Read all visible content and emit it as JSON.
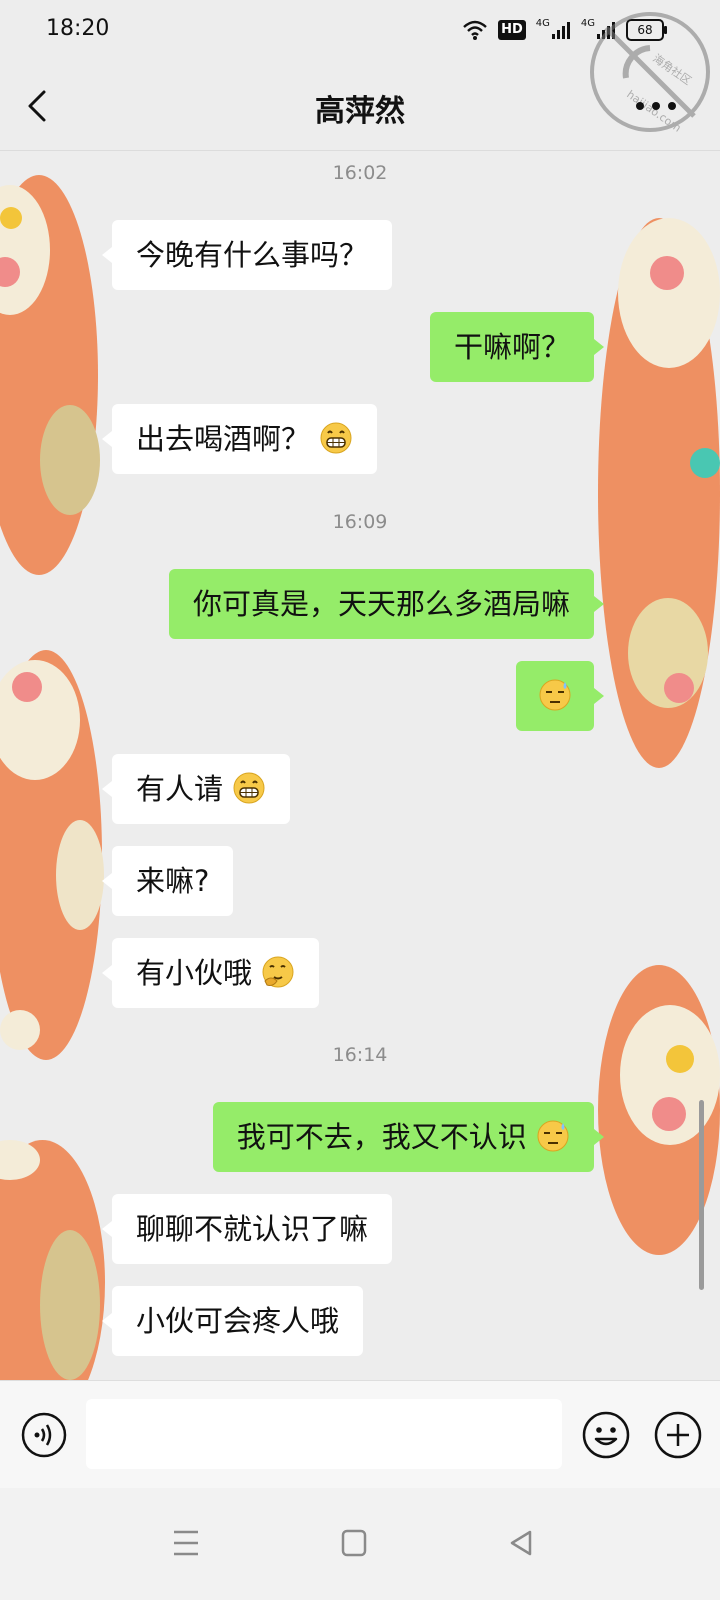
{
  "status_bar": {
    "time": "18:20",
    "network_1": "4G",
    "network_2": "4G",
    "battery": "68",
    "hd_label": "HD"
  },
  "watermark": {
    "line1": "海角社区",
    "line2": "haijiao.com"
  },
  "header": {
    "title": "高萍然"
  },
  "messages": [
    {
      "kind": "time",
      "text": "16:02"
    },
    {
      "kind": "msg",
      "side": "left",
      "text": "今晚有什么事吗？"
    },
    {
      "kind": "msg",
      "side": "right",
      "text": "干嘛啊？"
    },
    {
      "kind": "msg",
      "side": "left",
      "text": "出去喝酒啊？",
      "emoji": "grin-emoji"
    },
    {
      "kind": "time",
      "text": "16:09"
    },
    {
      "kind": "msg",
      "side": "right",
      "text": "你可真是，天天那么多酒局嘛"
    },
    {
      "kind": "msg",
      "side": "right",
      "text": "",
      "emoji": "sweat-emoji"
    },
    {
      "kind": "msg",
      "side": "left",
      "text": "有人请",
      "emoji": "grin-emoji"
    },
    {
      "kind": "msg",
      "side": "left",
      "text": "来嘛?"
    },
    {
      "kind": "msg",
      "side": "left",
      "text": "有小伙哦",
      "emoji": "thinking-emoji"
    },
    {
      "kind": "time",
      "text": "16:14"
    },
    {
      "kind": "msg",
      "side": "right",
      "text": "我可不去，我又不认识",
      "emoji": "sweat-emoji"
    },
    {
      "kind": "msg",
      "side": "left",
      "text": "聊聊不就认识了嘛"
    },
    {
      "kind": "msg",
      "side": "left",
      "text": "小伙可会疼人哦"
    }
  ],
  "input": {
    "value": "",
    "placeholder": ""
  },
  "colors": {
    "background": "#ededed",
    "self_bubble": "#95ec69",
    "other_bubble": "#ffffff",
    "timestamp": "#8c8c8c"
  }
}
